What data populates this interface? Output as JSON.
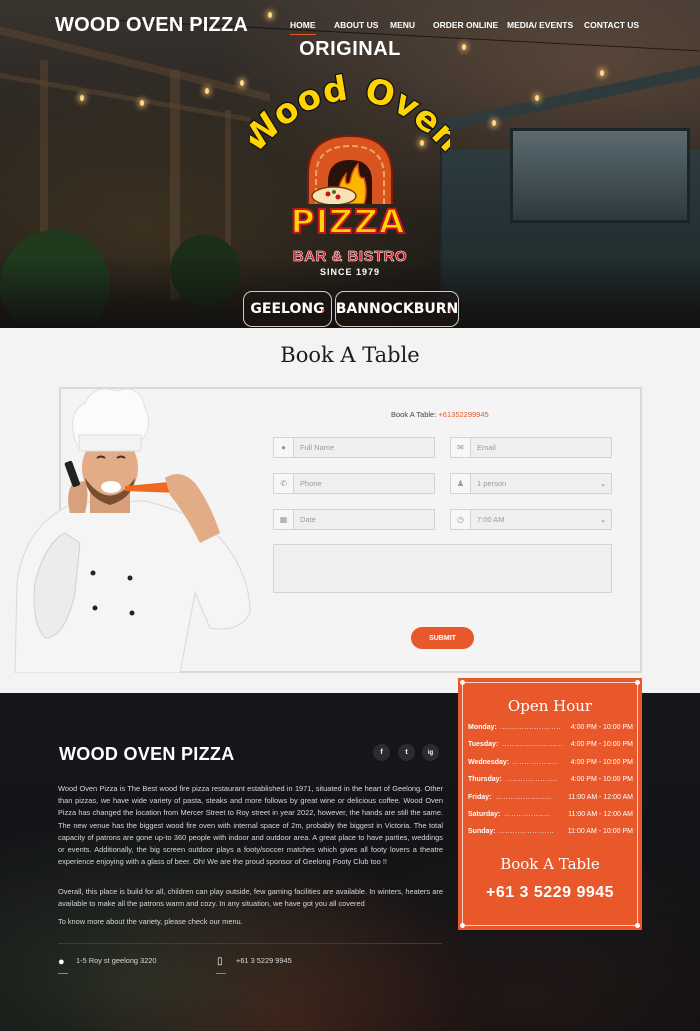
{
  "header": {
    "site_title": "WOOD OVEN PIZZA",
    "nav": [
      {
        "label": "HOME",
        "active": true
      },
      {
        "label": "ABOUT US"
      },
      {
        "label": "MENU"
      },
      {
        "label": "ORDER ONLINE"
      },
      {
        "label": "MEDIA/ EVENTS"
      },
      {
        "label": "CONTACT US"
      }
    ]
  },
  "logo": {
    "top_text": "ORIGINAL",
    "arc_text": "Wood Oven",
    "main_text": "PIZZA",
    "sub_text": "BAR & BISTRO",
    "since_text": "SINCE 1979"
  },
  "locations": [
    {
      "label": "GEELONG"
    },
    {
      "label": "BANNOCKBURN"
    }
  ],
  "booking": {
    "title": "Book A Table",
    "phone_label": "Book A Table:",
    "phone_number": "+61352299945",
    "fields": {
      "full_name": "Full Name",
      "email": "Email",
      "phone": "Phone",
      "persons": "1 person",
      "date": "Date",
      "time": "7:00 AM"
    },
    "submit_label": "SUBMIT"
  },
  "footer": {
    "title": "WOOD OVEN PIZZA",
    "social": [
      "f",
      "t",
      "ig"
    ],
    "para1": "Wood Oven Pizza is The Best wood fire pizza restaurant established in 1971, situated in the heart of Geelong. Other than pizzas, we have wide variety of pasta, steaks and more follows by great wine or delicious coffee. Wood Oven Pizza has changed the location from Mercer Street to Roy street in year 2022, however, the hands are still the same. The new venue has the biggest wood fire oven with internal space of 2m, probably the biggest in Victoria. The total capacity of patrons are gone up-to 360 people with indoor and outdoor area. A great place to have parties, weddings or events. Additionally, the big screen outdoor plays a footy/soccer matches which gives all footy lovers a theatre experience enjoying with a glass of beer. Oh! We are the proud sponsor of Geelong Footy Club too !!",
    "para2": "Overall, this place is build for all, children can play outside, few gaming facilities are available. In winters, heaters are available to make all the patrons warm and cozy. In any situation, we have got you all covered",
    "para3": "To know more about the variety, please check our menu.",
    "address": "1-5 Roy st geelong 3220",
    "phone": "+61 3 5229 9945"
  },
  "hours": {
    "title": "Open Hour",
    "rows": [
      {
        "day": "Monday:",
        "time": "4:00 PM - 10:00 PM"
      },
      {
        "day": "Tuesday:",
        "time": "4:00 PM - 10:00 PM"
      },
      {
        "day": "Wednesday:",
        "time": "4:00 PM - 10:00 PM"
      },
      {
        "day": "Thursday:",
        "time": "4:00 PM - 10:00 PM"
      },
      {
        "day": "Friday:",
        "time": "11:00 AM - 12:00 AM"
      },
      {
        "day": "Saturday:",
        "time": "11:00 AM - 12:00 AM"
      },
      {
        "day": "Sunday:",
        "time": "11:00 AM - 10:00 PM"
      }
    ],
    "book_title": "Book A Table",
    "book_phone": "+61 3 5229 9945"
  },
  "colors": {
    "accent": "#e8582a",
    "footer_bg": "#131417",
    "booking_bg": "#f3f3f3"
  }
}
